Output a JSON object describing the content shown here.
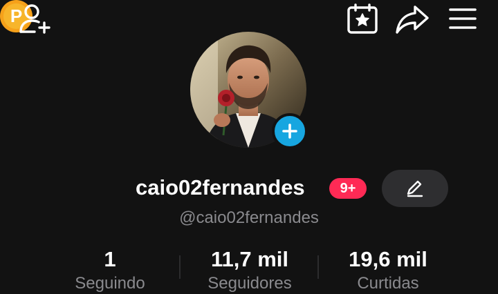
{
  "header": {
    "add_friend_icon": "person-plus-icon",
    "coin_icon": "coin-icon",
    "coin_letter": "P",
    "calendar_icon": "calendar-star-icon",
    "share_icon": "share-arrow-icon",
    "menu_icon": "hamburger-menu-icon"
  },
  "profile": {
    "display_name": "caio02fernandes",
    "notification_badge": "9+",
    "handle": "@caio02fernandes",
    "edit_icon": "pencil-icon",
    "add_avatar_icon": "plus-icon"
  },
  "stats": [
    {
      "value": "1",
      "label": "Seguindo"
    },
    {
      "value": "11,7 mil",
      "label": "Seguidores"
    },
    {
      "value": "19,6 mil",
      "label": "Curtidas"
    }
  ],
  "colors": {
    "background": "#121212",
    "badge": "#ff2a55",
    "add_avatar": "#17a6e0",
    "coin": "#f6a11a",
    "muted_text": "#8a8a8e"
  }
}
